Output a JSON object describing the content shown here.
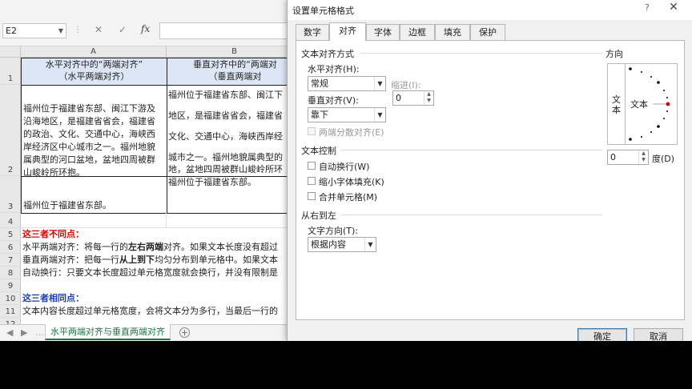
{
  "excel": {
    "name_box": "E2",
    "formula_cancel_icon": "✕",
    "formula_enter_icon": "✓",
    "formula_fx": "fx",
    "columns": [
      "A",
      "B"
    ],
    "rows": [
      "1",
      "2",
      "3",
      "4",
      "5",
      "6",
      "7",
      "8",
      "9",
      "10",
      "11",
      "12"
    ],
    "a1_line1": "水平对齐中的“两端对齐”",
    "a1_line2": "（水平两端对齐）",
    "b1_line1": "垂直对齐中的“两端对",
    "b1_line2": "（垂直两端对",
    "a2_lines": [
      "福州位于福建省东部、闽江下游及",
      "沿海地区，是福建省省会，福建省",
      "的政治、文化、交通中心，海峡西",
      "岸经济区中心城市之一。福州地貌",
      "属典型的河口盆地，盆地四周被群",
      "山峻岭所环抱。"
    ],
    "b2_lines": [
      "福州位于福建省东部、闽江下",
      "地区，是福建省省会，福建省",
      "文化、交通中心，海峡西岸经",
      "城市之一。福州地貌属典型的",
      "地，盆地四周被群山峻岭所环"
    ],
    "a3": "福州位于福建省东部。",
    "b3": "福州位于福建省东部。",
    "r5": "这三者不同点：",
    "r6_pre": "水平两端对齐：将每一行的",
    "r6_bold": "左右两端",
    "r6_post": "对齐。如果文本长度没有超过",
    "r7_pre": "垂直两端对齐：把每一行",
    "r7_bold": "从上到下",
    "r7_post": "均匀分布到单元格中。如果文本",
    "r8": "自动换行：只要文本长度超过单元格宽度就会换行，并没有限制是",
    "r10": "这三者相同点：",
    "r11": "文本内容长度超过单元格宽度，会将文本分为多行，当最后一行的",
    "sheet_tab": "水平两端对齐与垂直两端对齐",
    "add_sheet": "+"
  },
  "dialog": {
    "title": "设置单元格格式",
    "help": "?",
    "close": "✕",
    "tabs": [
      "数字",
      "对齐",
      "字体",
      "边框",
      "填充",
      "保护"
    ],
    "active_tab": "对齐",
    "alignment": {
      "section": "文本对齐方式",
      "horizontal_label": "水平对齐(H):",
      "horizontal_value": "常规",
      "indent_label": "缩进(I):",
      "indent_value": "0",
      "vertical_label": "垂直对齐(V):",
      "vertical_value": "靠下",
      "distributed": "两端分散对齐(E)"
    },
    "control": {
      "section": "文本控制",
      "wrap": "自动换行(W)",
      "shrink": "缩小字体填充(K)",
      "merge": "合并单元格(M)"
    },
    "rtl": {
      "section": "从右到左",
      "direction_label": "文字方向(T):",
      "direction_value": "根据内容"
    },
    "orientation": {
      "section": "方向",
      "vertical_text": "文本",
      "dial_text": "文本",
      "degrees": "0",
      "degree_label": "度(D)"
    },
    "ok": "确定",
    "cancel": "取消"
  },
  "colors": {
    "header_fill": "#dde6f4",
    "red_heading": "#e00000",
    "blue_heading": "#1b3fb0",
    "sheet_tab": "#217346",
    "dial_red": "#cc0000"
  }
}
